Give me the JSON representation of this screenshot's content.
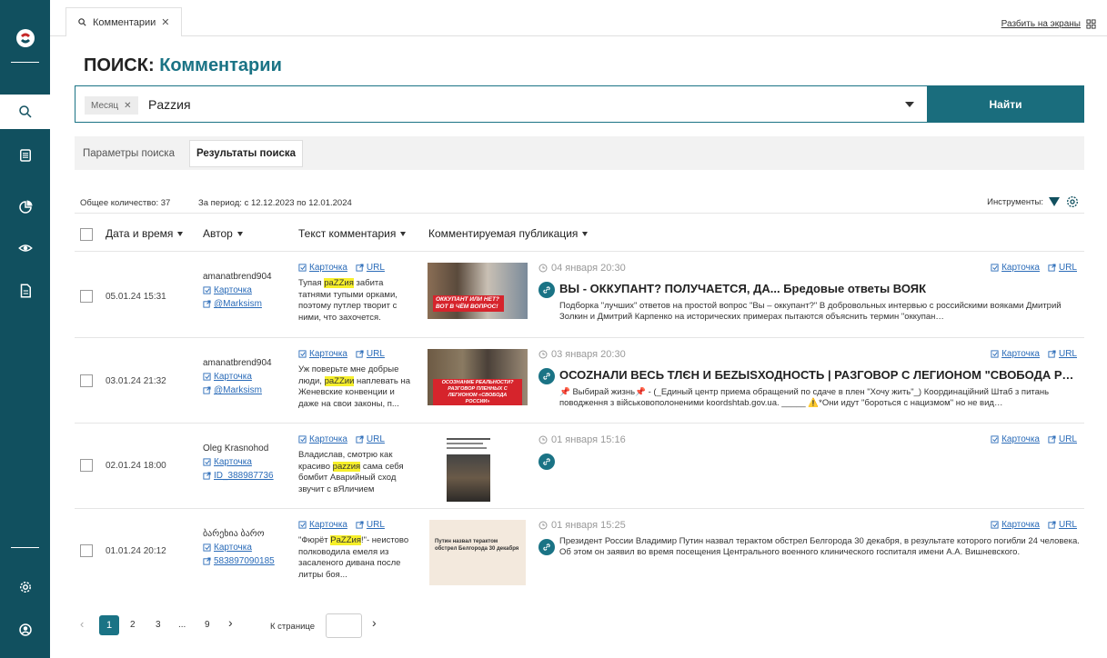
{
  "tab": {
    "label": "Комментарии"
  },
  "topbar": {
    "split_label": "Разбить на экраны"
  },
  "page": {
    "title_prefix": "ПОИСК:",
    "title": "Комментарии"
  },
  "search": {
    "chip": "Месяц",
    "value": "Pazzия",
    "button": "Найти"
  },
  "tabs": {
    "params": "Параметры поиска",
    "results": "Результаты поиска"
  },
  "summary": {
    "total": "Общее количество: 37",
    "period": "За период: с 12.12.2023 по 12.01.2024",
    "tools": "Инструменты:"
  },
  "columns": {
    "date": "Дата и время",
    "author": "Автор",
    "text": "Текст комментария",
    "publication": "Комментируемая публикация"
  },
  "links": {
    "card": "Карточка",
    "url": "URL"
  },
  "rows": [
    {
      "date": "05.01.24 15:31",
      "author": "amanatbrend904",
      "handle": "@Marksism",
      "text_pre": "Тупая ",
      "text_mark": "paZZия",
      "text_post": " забита татнями тупыми орками, поэтому путлер творит с ними, что захочется.",
      "thumb_caption": "ОККУПАНТ ИЛИ НЕТ? ВОТ В ЧЁМ ВОПРОС!",
      "pub_date": "04 января 20:30",
      "pub_title": "ВЫ - ОККУПАНТ? ПОЛУЧАЕТСЯ, ДА... Бредовые ответы ВОЯК",
      "pub_desc": "Подборка \"лучших\" ответов на простой вопрос \"Вы – оккупант?\" В добровольных интервью с российскими вояками Дмитрий Золкин и Дмитрий Карпенко на исторических примерах пытаются объяснить термин \"оккупан…"
    },
    {
      "date": "03.01.24 21:32",
      "author": "amanatbrend904",
      "handle": "@Marksism",
      "text_pre": "Уж поверьте мне добрые люди, ",
      "text_mark": "paZZии",
      "text_post": " наплевать на Женевские конвенции и даже на свои законы, п...",
      "thumb_caption": "ОСОЗНАНИЕ РЕАЛЬНОСТИ? РАЗГОВОР ПЛЕННЫХ С ЛЕГИОНОМ «СВОБОДА РОССИИ»",
      "pub_date": "03 января 20:30",
      "pub_title": "ОСОZНАЛИ ВЕСЬ ТЛЄН И БЕZЫSХОДНОСТЬ | РАЗГОВОР С ЛЕГИОНОМ \"СВОБОДА РОС…",
      "pub_desc": "📌 Выбирай жизнь📌 - (_Единый центр приема обращений по сдаче в плен \"Хочу жить\"_) Координаційний Штаб з питань поводження з військовополоненими koordshtab.gov.ua. _____ ⚠️*Они идут \"бороться с нацизмом\" но не вид…"
    },
    {
      "date": "02.01.24 18:00",
      "author": "Oleg Krasnohod",
      "handle": "ID_388987736",
      "text_pre": "Владислав, смотрю как красиво ",
      "text_mark": "pazzия",
      "text_post": " сама себя бомбит Аварийный сход звучит с вЯличием",
      "thumb_caption": "",
      "pub_date": "01 января 15:16",
      "pub_title": "",
      "pub_desc": ""
    },
    {
      "date": "01.01.24 20:12",
      "author": "ბარეხია ბარო",
      "handle": "583897090185",
      "text_pre": "\"Фюрёт ",
      "text_mark": "PaZZия",
      "text_post": "!\"- неистово полководила емеля из засаленого дивана после литры боя...",
      "thumb_caption": "Путин назвал терактом обстрел Белгорода 30 декабря",
      "pub_date": "01 января 15:25",
      "pub_title": "",
      "pub_desc": "Президент России Владимир Путин назвал терактом обстрел Белгорода 30 декабря, в результате которого погибли 24 человека. Об этом он заявил во время посещения Центрального военного клинического госпиталя имени А.А. Вишневского."
    }
  ],
  "pagination": {
    "pages": [
      "1",
      "2",
      "3",
      "...",
      "9"
    ],
    "goto_label": "К странице"
  }
}
